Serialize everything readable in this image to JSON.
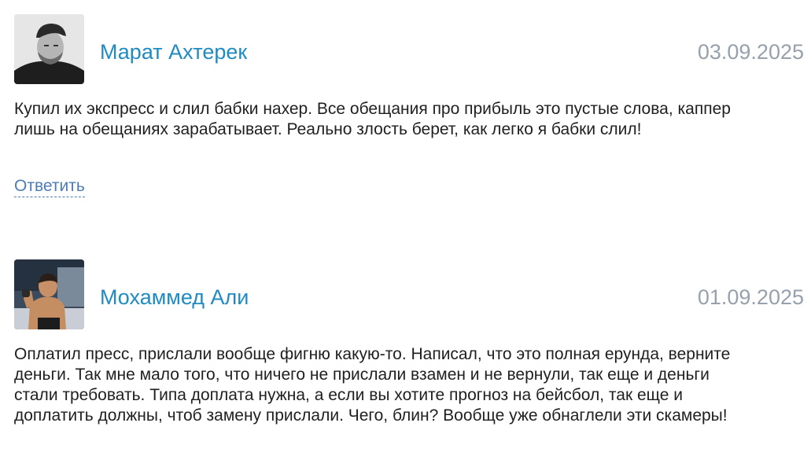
{
  "comments": [
    {
      "author": "Марат Ахтерек",
      "date": "03.09.2025",
      "avatar_icon": "user-photo-grayscale",
      "text": "Купил их экспресс и слил бабки нахер. Все обещания про прибыль это пустые слова, каппер лишь на обещаниях зарабатывает. Реально злость берет, как легко я бабки слил!",
      "reply_label": "Ответить"
    },
    {
      "author": "Мохаммед Али",
      "date": "01.09.2025",
      "avatar_icon": "user-photo-fighter",
      "text": "Оплатил пресс, прислали вообще фигню какую-то. Написал, что это полная ерунда, верните деньги. Так мне мало того, что ничего не прислали взамен и не вернули, так еще и деньги стали требовать. Типа доплата нужна, а если вы хотите прогноз на бейсбол, так еще и доплатить должны, чтоб замену прислали. Чего, блин? Вообще уже обнаглели эти скамеры!"
    }
  ],
  "colors": {
    "author": "#1f8bc2",
    "date": "#97a1ad",
    "reply": "#4d7cb5",
    "text": "#1f1f1f"
  }
}
